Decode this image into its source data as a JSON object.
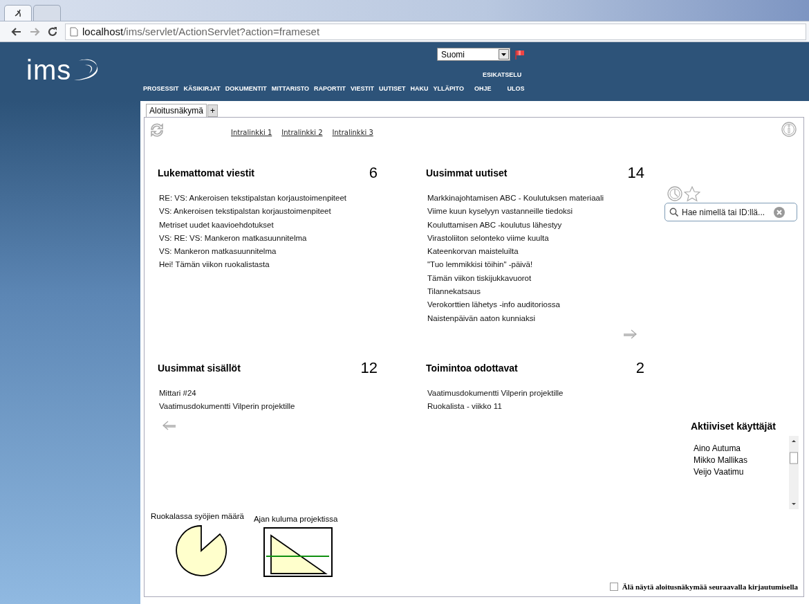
{
  "browser": {
    "url_host": "localhost",
    "url_path": "/ims/servlet/ActionServlet?action=frameset"
  },
  "header": {
    "logo": "ims",
    "language": "Suomi",
    "preview_link": "ESIKATSELU",
    "nav": [
      {
        "label": "PROSESSIT"
      },
      {
        "label": "KÄSIKIRJAT"
      },
      {
        "label": "DOKUMENTIT"
      },
      {
        "label": "MITTARISTO"
      },
      {
        "label": "RAPORTIT"
      },
      {
        "label": "VIESTIT"
      },
      {
        "label": "UUTISET"
      },
      {
        "label": "HAKU"
      },
      {
        "label": "YLLÄPITO"
      },
      {
        "label": "OHJE"
      },
      {
        "label": "ULOS"
      }
    ]
  },
  "tabs": [
    {
      "label": "Aloitusnäkymä",
      "selected": true
    }
  ],
  "add_tab": "+",
  "intralinks": [
    "Intralinkki 1",
    "Intralinkki 2",
    "Intralinkki 3"
  ],
  "widgets": [
    {
      "title": "Lukemattomat viestit",
      "count": "6",
      "items": [
        "RE: VS: Ankeroisen tekstipalstan korjaustoimenpiteet",
        "VS: Ankeroisen tekstipalstan korjaustoimenpiteet",
        "Metriset uudet kaavioehdotukset",
        "VS: RE: VS: Mankeron matkasuunnitelma",
        "VS: Mankeron matkasuunnitelma",
        "Hei! Tämän viikon ruokalistasta"
      ]
    },
    {
      "title": "Uusimmat uutiset",
      "count": "14",
      "has_next": true,
      "items": [
        "Markkinajohtamisen ABC - Koulutuksen materiaali",
        "Viime kuun kyselyyn vastanneille tiedoksi",
        "Kouluttamisen ABC -koulutus lähestyy",
        "Virastoliiton selonteko viime kuulta",
        "Kateenkorvan maisteluilta",
        "\"Tuo lemmikkisi töihin\" -päivä!",
        "Tämän viikon tiskijukkavuorot",
        "Tilannekatsaus",
        "Verokorttien lähetys -info auditoriossa",
        "Naistenpäivän aaton kunniaksi"
      ]
    },
    {
      "title": "Uusimmat sisällöt",
      "count": "12",
      "has_previous": true,
      "items": [
        "Mittari #24",
        "Vaatimusdokumentti Vilperin projektille"
      ]
    },
    {
      "title": "Toimintoa odottavat",
      "count": "2",
      "items": [
        "Vaatimusdokumentti Vilperin projektille",
        "Ruokalista - viikko 11"
      ]
    }
  ],
  "search": {
    "placeholder": "Hae nimellä tai ID:llä..."
  },
  "active_users": {
    "title": "Aktiiviset käyttäjät",
    "users": [
      "Aino Autuma",
      "Mikko Mallikas",
      "Veijo Vaatimu"
    ]
  },
  "charts": [
    {
      "title": "Ruokalassa syöjien määrä",
      "kind": "pie"
    },
    {
      "title": "Ajan kuluma projektissa",
      "kind": "triangle"
    }
  ],
  "footer_option": {
    "label": "Älä näytä aloitusnäkymää seuraavalla kirjautumisella",
    "checked": false
  }
}
